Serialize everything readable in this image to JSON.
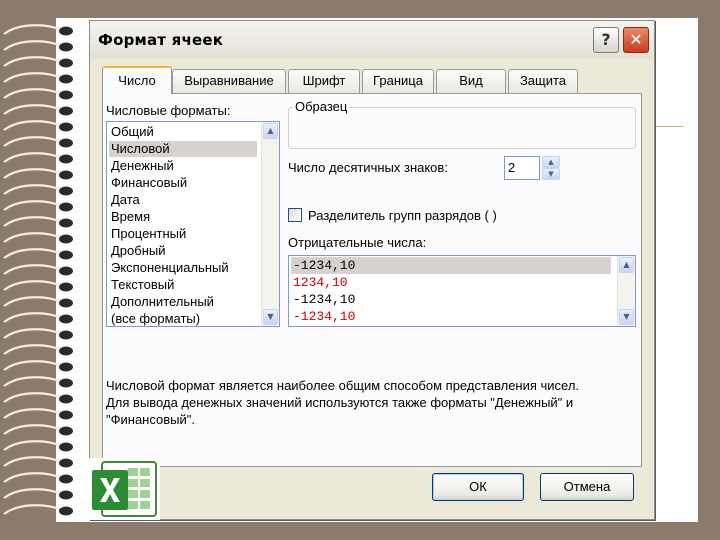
{
  "dialog": {
    "title": "Формат ячеек",
    "help_symbol": "?",
    "close_symbol": "✕"
  },
  "tabs": [
    {
      "label": "Число",
      "active": true
    },
    {
      "label": "Выравнивание",
      "active": false
    },
    {
      "label": "Шрифт",
      "active": false
    },
    {
      "label": "Граница",
      "active": false
    },
    {
      "label": "Вид",
      "active": false
    },
    {
      "label": "Защита",
      "active": false
    }
  ],
  "formats": {
    "label": "Числовые форматы:",
    "items": [
      "Общий",
      "Числовой",
      "Денежный",
      "Финансовый",
      "Дата",
      "Время",
      "Процентный",
      "Дробный",
      "Экспоненциальный",
      "Текстовый",
      "Дополнительный",
      "(все форматы)"
    ],
    "selected": "Числовой"
  },
  "sample": {
    "label": "Образец",
    "value": ""
  },
  "decimals": {
    "label": "Число десятичных знаков:",
    "value": "2"
  },
  "separator": {
    "label": "Разделитель групп разрядов ( )",
    "checked": false
  },
  "negative": {
    "label": "Отрицательные числа:",
    "items": [
      {
        "text": "-1234,10",
        "color": "#000000",
        "selected": true
      },
      {
        "text": "1234,10",
        "color": "#cc0000",
        "selected": false
      },
      {
        "text": "-1234,10",
        "color": "#000000",
        "selected": false
      },
      {
        "text": "-1234,10",
        "color": "#cc0000",
        "selected": false
      }
    ]
  },
  "description": {
    "lines": [
      "Числовой формат является наиболее общим способом представления чисел.",
      "Для вывода денежных значений используются также форматы \"Денежный\" и",
      "\"Финансовый\"."
    ]
  },
  "buttons": {
    "ok": "ОК",
    "cancel": "Отмена"
  },
  "icons": {
    "app": "excel-icon",
    "scroll_up": "scroll-up-icon",
    "scroll_down": "scroll-down-icon"
  },
  "colors": {
    "dialog_bg": "#ece9d8",
    "selection": "#d6d3ce",
    "negative_red": "#cc0000",
    "close_button": "#c4401f",
    "active_tab_accent": "#f0b34a"
  }
}
